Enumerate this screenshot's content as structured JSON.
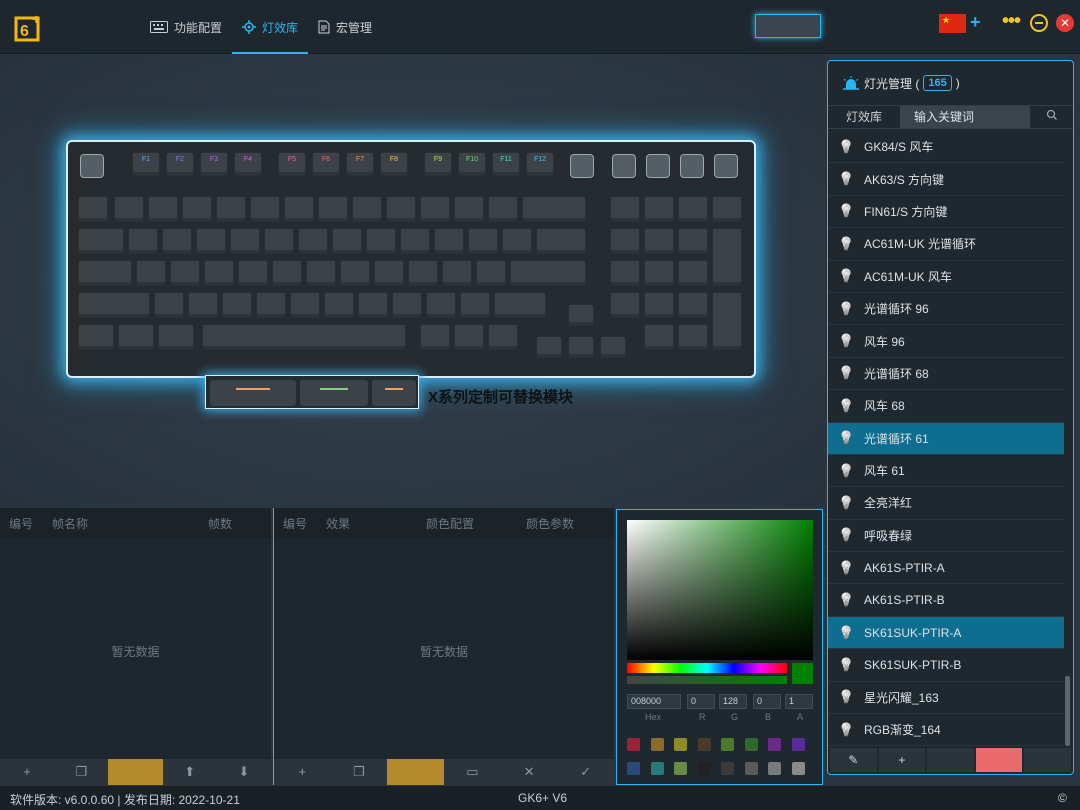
{
  "nav": {
    "items": [
      {
        "label": "功能配置",
        "icon": "keyboard-icon"
      },
      {
        "label": "灯效库",
        "icon": "gear-icon"
      },
      {
        "label": "宏管理",
        "icon": "document-icon"
      }
    ]
  },
  "keyboard": {
    "fn_row": [
      "F1",
      "F2",
      "F3",
      "F4",
      "F5",
      "F6",
      "F7",
      "F8",
      "F9",
      "F10",
      "F11",
      "F12"
    ],
    "module_label": "X系列定制可替换模块"
  },
  "light_panel": {
    "title": "灯光管理 (",
    "title_end": ")",
    "count": "165",
    "tab": "灯效库",
    "search_placeholder": "输入关键词",
    "items": [
      {
        "label": "GK84/S 风车",
        "selected": false
      },
      {
        "label": "AK63/S 方向键",
        "selected": false
      },
      {
        "label": "FIN61/S 方向键",
        "selected": false
      },
      {
        "label": "AC61M-UK 光谱循环",
        "selected": false
      },
      {
        "label": "AC61M-UK 风车",
        "selected": false
      },
      {
        "label": "光谱循环 96",
        "selected": false
      },
      {
        "label": "风车 96",
        "selected": false
      },
      {
        "label": "光谱循环 68",
        "selected": false
      },
      {
        "label": "风车 68",
        "selected": false
      },
      {
        "label": "光谱循环 61",
        "selected": true
      },
      {
        "label": "风车 61",
        "selected": false
      },
      {
        "label": "全亮洋红",
        "selected": false
      },
      {
        "label": "呼吸春绿",
        "selected": false
      },
      {
        "label": "AK61S-PTIR-A",
        "selected": false
      },
      {
        "label": "AK61S-PTIR-B",
        "selected": false
      },
      {
        "label": "SK61SUK-PTIR-A",
        "selected": true
      },
      {
        "label": "SK61SUK-PTIR-B",
        "selected": false
      },
      {
        "label": "星光闪耀_163",
        "selected": false
      },
      {
        "label": "RGB渐变_164",
        "selected": false
      }
    ]
  },
  "frames_panel": {
    "headers": [
      "编号",
      "帧名称",
      "帧数"
    ],
    "empty": "暂无数据"
  },
  "effects_panel": {
    "headers": [
      "编号",
      "效果",
      "颜色配置",
      "颜色参数"
    ],
    "empty": "暂无数据"
  },
  "color_picker": {
    "hex": "008000",
    "r": "0",
    "g": "128",
    "b": "0",
    "a": "1",
    "labels": [
      "Hex",
      "R",
      "G",
      "B",
      "A"
    ],
    "swatches": [
      "#9b2335",
      "#8c6a2a",
      "#8f8a2a",
      "#4a3a2a",
      "#4a7a2a",
      "#2f6a2a",
      "#6a2a8a",
      "#5a2a9a",
      "#2a4a7a",
      "#2a7a7a",
      "#6a8a4a",
      "#222222",
      "#3a3a3a",
      "#5a5a5a",
      "#7a7a7a",
      "#8a8a8a"
    ]
  },
  "status": {
    "left": "软件版本: v6.0.0.60 | 发布日期: 2022-10-21",
    "center": "GK6+ V6",
    "right": "©"
  }
}
